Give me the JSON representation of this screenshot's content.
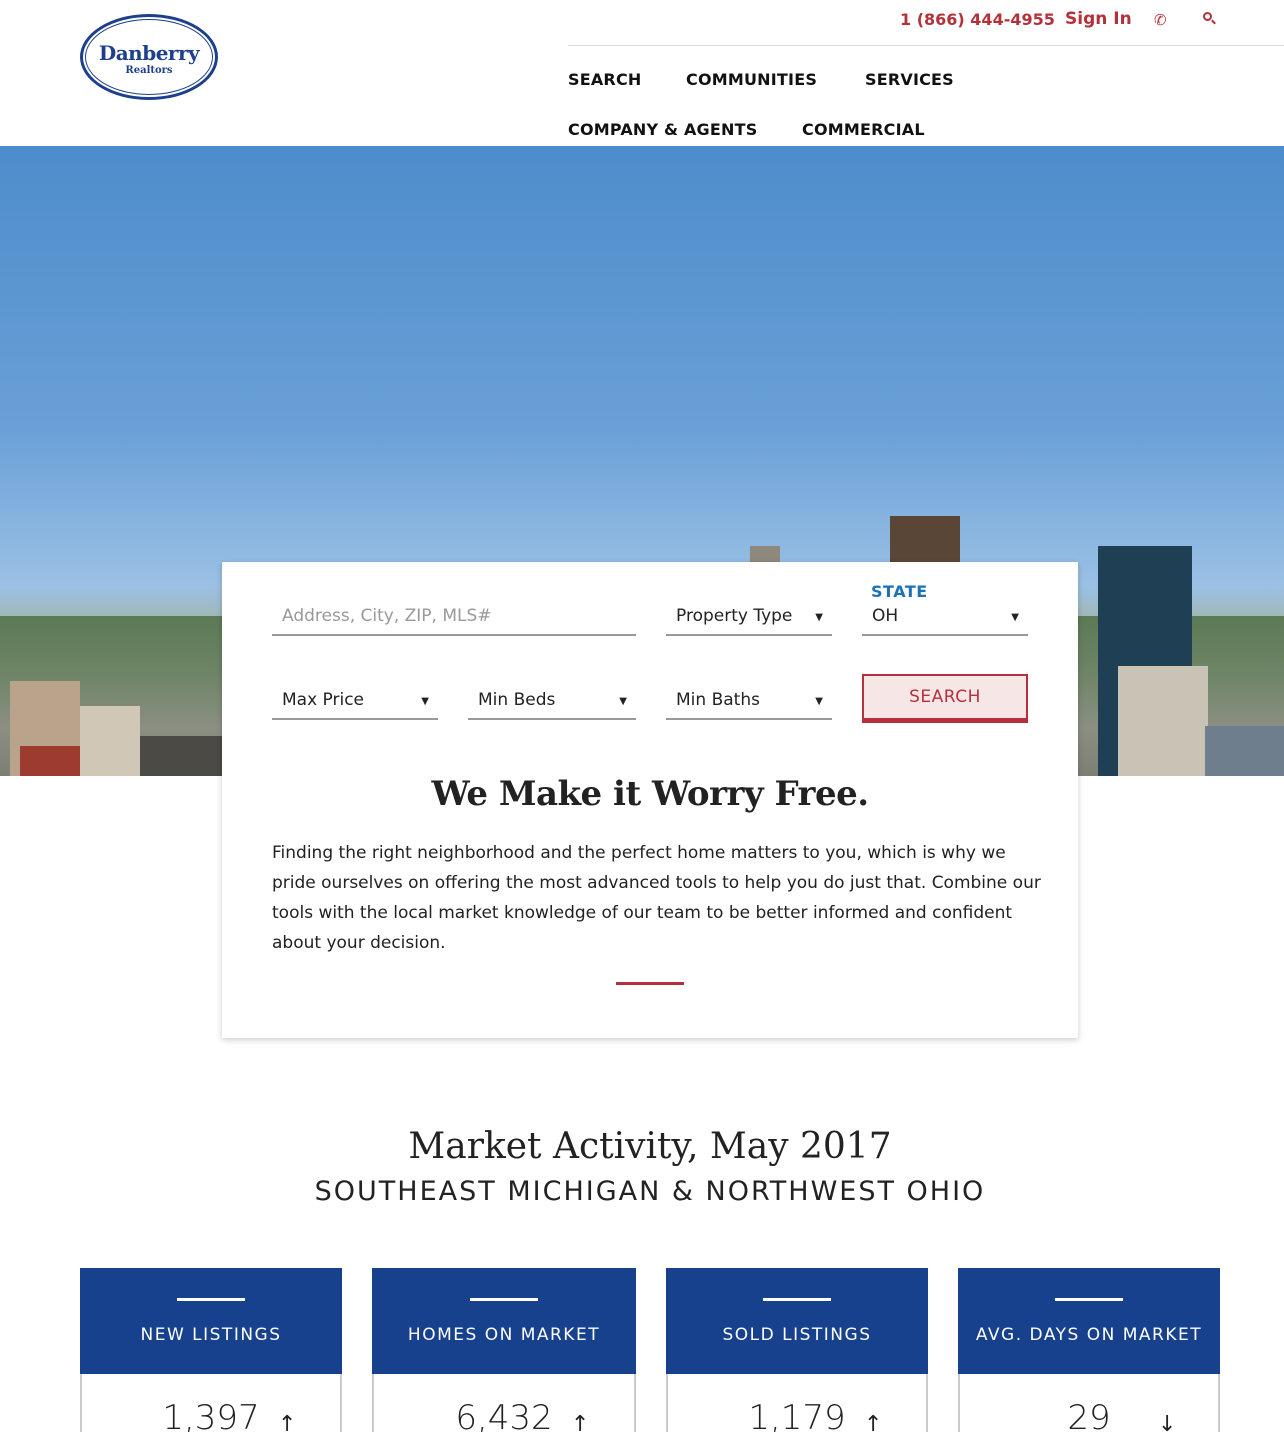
{
  "brand": {
    "name": "Danberry",
    "sub": "Realtors",
    "color": "#1d3f8c"
  },
  "header": {
    "phone": "1 (866) 444-4955",
    "sign_in": "Sign In",
    "phone_icon": "phone-icon",
    "search_icon": "search-icon",
    "accent": "#b5313a"
  },
  "nav": [
    "SEARCH",
    "COMMUNITIES",
    "SERVICES",
    "COMPANY & AGENTS",
    "COMMERCIAL"
  ],
  "search": {
    "address_placeholder": "Address, City, ZIP, MLS#",
    "property_type": "Property Type",
    "state_label": "STATE",
    "state_value": "OH",
    "max_price": "Max Price",
    "min_beds": "Min Beds",
    "min_baths": "Min Baths",
    "button": "SEARCH"
  },
  "intro": {
    "headline": "We Make it Worry Free.",
    "body": "Finding the right neighborhood and the perfect home matters to you, which is why we pride ourselves on offering the most advanced tools to help you do just that. Combine our tools with the local market knowledge of our team to be better informed and confident about your decision."
  },
  "market": {
    "title": "Market Activity, May 2017",
    "subtitle": "SOUTHEAST MICHIGAN & NORTHWEST OHIO",
    "stats": [
      {
        "label": "NEW LISTINGS",
        "value": "1,397",
        "trend": "up"
      },
      {
        "label": "HOMES ON MARKET",
        "value": "6,432",
        "trend": "up"
      },
      {
        "label": "SOLD LISTINGS",
        "value": "1,179",
        "trend": "up"
      },
      {
        "label": "AVG. DAYS ON MARKET",
        "value": "29",
        "trend": "down"
      }
    ],
    "header_color": "#17418c"
  }
}
